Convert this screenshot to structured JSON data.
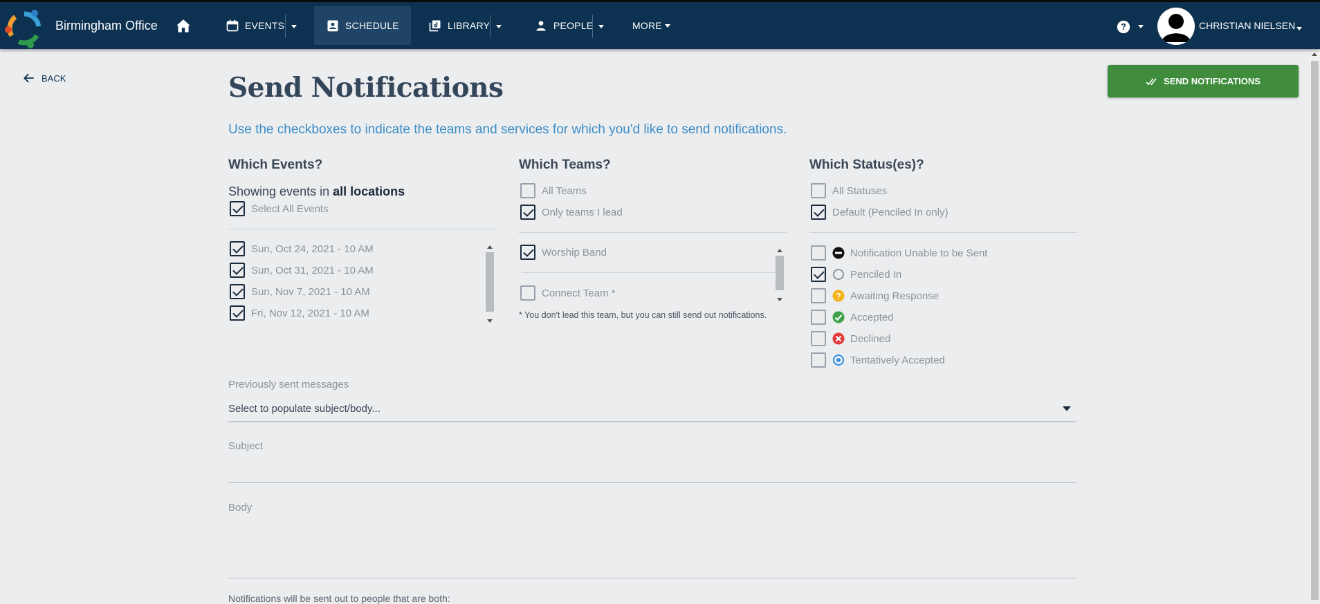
{
  "nav": {
    "brand": "Birmingham Office",
    "events": "EVENTS",
    "schedule": "SCHEDULE",
    "library": "LIBRARY",
    "people": "PEOPLE",
    "more": "MORE",
    "user": "CHRISTIAN NIELSEN",
    "active_tab": "SCHEDULE",
    "colors": {
      "bar": "#0d3150",
      "active": "#1f4466"
    }
  },
  "page": {
    "back": "BACK",
    "title": "Send Notifications",
    "send_button": "SEND NOTIFICATIONS",
    "subtitle": "Use the checkboxes to indicate the teams and services for which you'd like to send notifications."
  },
  "events": {
    "heading": "Which Events?",
    "showing_prefix": "Showing events in",
    "showing_location": "all locations",
    "select_all": {
      "label": "Select All Events",
      "checked": true
    },
    "items": [
      {
        "label": "Sun, Oct 24, 2021 - 10 AM",
        "checked": true
      },
      {
        "label": "Sun, Oct 31, 2021 - 10 AM",
        "checked": true
      },
      {
        "label": "Sun, Nov 7, 2021 - 10 AM",
        "checked": true
      },
      {
        "label": "Fri, Nov 12, 2021 - 10 AM",
        "checked": true
      }
    ]
  },
  "teams": {
    "heading": "Which Teams?",
    "all_teams": {
      "label": "All Teams",
      "checked": false
    },
    "only_mine": {
      "label": "Only teams I lead",
      "checked": true
    },
    "items": [
      {
        "label": "Worship Band",
        "checked": true
      },
      {
        "label": "Connect Team *",
        "checked": false
      }
    ],
    "footnote": "* You don't lead this team, but you can still send out notifications."
  },
  "statuses": {
    "heading": "Which Status(es)?",
    "all": {
      "label": "All Statuses",
      "checked": false
    },
    "default": {
      "label": "Default (Penciled In only)",
      "checked": true
    },
    "items": [
      {
        "label": "Notification Unable to be Sent",
        "checked": false,
        "icon": "minus-circle-icon"
      },
      {
        "label": "Penciled In",
        "checked": true,
        "icon": "empty-circle-icon"
      },
      {
        "label": "Awaiting Response",
        "checked": false,
        "icon": "question-circle-icon"
      },
      {
        "label": "Accepted",
        "checked": false,
        "icon": "check-circle-icon"
      },
      {
        "label": "Declined",
        "checked": false,
        "icon": "x-circle-icon"
      },
      {
        "label": "Tentatively Accepted",
        "checked": false,
        "icon": "dot-circle-icon"
      }
    ]
  },
  "form": {
    "previous_label": "Previously sent messages",
    "previous_placeholder": "Select to populate subject/body...",
    "subject_label": "Subject",
    "body_label": "Body",
    "bottom_note": "Notifications will be sent out to people that are both:"
  }
}
